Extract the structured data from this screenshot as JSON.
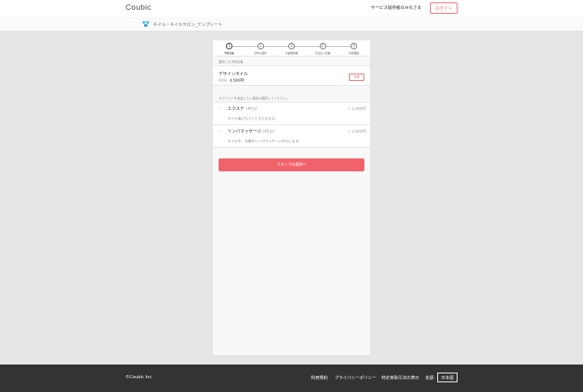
{
  "header": {
    "logo": "Coubic",
    "provider_link": "サービス提供者のみなさま",
    "login_label": "ログイン"
  },
  "subheader": {
    "shop_name": "ネイル・ネイルサロン_テンプレート"
  },
  "steps": [
    {
      "number": "1",
      "label": "予約対象",
      "active": true
    },
    {
      "number": "2",
      "label": "日時の選択",
      "active": false
    },
    {
      "number": "3",
      "label": "お客様情報",
      "active": false
    },
    {
      "number": "4",
      "label": "お支払い情報",
      "active": false
    },
    {
      "number": "5",
      "label": "内容確認",
      "active": false
    }
  ],
  "selected": {
    "section_label": "選択した予約対象",
    "menu_name": "デザインネイル",
    "duration": "60分",
    "price": "4,500円",
    "change_label": "変更"
  },
  "options": {
    "section_label": "オプションを追加したい場合は選択してください。",
    "items": [
      {
        "name": "エクステ",
        "duration": "(45分)",
        "price": "+ 2,000円",
        "description": "ネイル後に行うこともできます。"
      },
      {
        "name": "リンパマッサージ",
        "duration": "(45分)",
        "price": "+ 2,000円",
        "description": "ネイル中、お隣のリンパマッサージを行います。"
      }
    ]
  },
  "cta_label": "スタッフの選択へ",
  "footer": {
    "copyright": "©Coubic Inc.",
    "links": [
      "利用規約",
      "プライバシーポリシー",
      "特定商取引法の表示"
    ],
    "language_label": "言語:",
    "language_value": "日本語"
  },
  "colors": {
    "accent": "#f2626a",
    "background": "#e6e6e6",
    "footer": "#333333"
  }
}
